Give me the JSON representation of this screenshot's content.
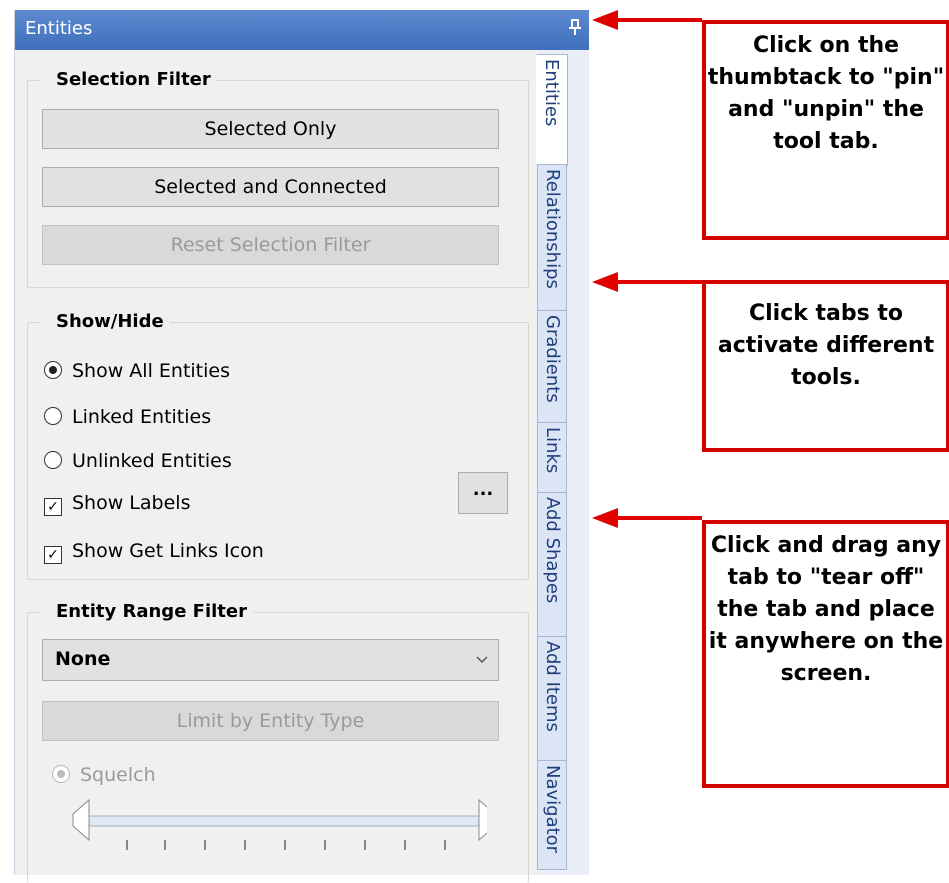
{
  "panel": {
    "title": "Entities",
    "pin_glyph": "⇣"
  },
  "selection_filter": {
    "title": "Selection Filter",
    "buttons": [
      "Selected Only",
      "Selected and Connected",
      "Reset Selection Filter"
    ]
  },
  "show_hide": {
    "title": "Show/Hide",
    "radios": [
      "Show All Entities",
      "Linked Entities",
      "Unlinked Entities"
    ],
    "selected_radio": "Show All Entities",
    "checkboxes": [
      "Show Labels",
      "Show Get Links Icon"
    ],
    "more_button": "..."
  },
  "range_filter": {
    "title": "Entity Range Filter",
    "select_value": "None",
    "limit_button": "Limit by Entity Type",
    "squelch_label": "Squelch"
  },
  "tabs": [
    "Entities",
    "Relationships",
    "Gradients",
    "Links",
    "Add Shapes",
    "Add Items",
    "Navigator"
  ],
  "active_tab": "Entities",
  "callouts": [
    "Click on the thumbtack to \"pin\" and \"unpin\" the tool tab.",
    "Click tabs to activate different tools.",
    "Click and drag any tab to \"tear off\" the tab and place it anywhere on the screen."
  ],
  "colors": {
    "titlebar": "#4a78c6",
    "callout_border": "#d40000",
    "arrow": "#e00000"
  }
}
